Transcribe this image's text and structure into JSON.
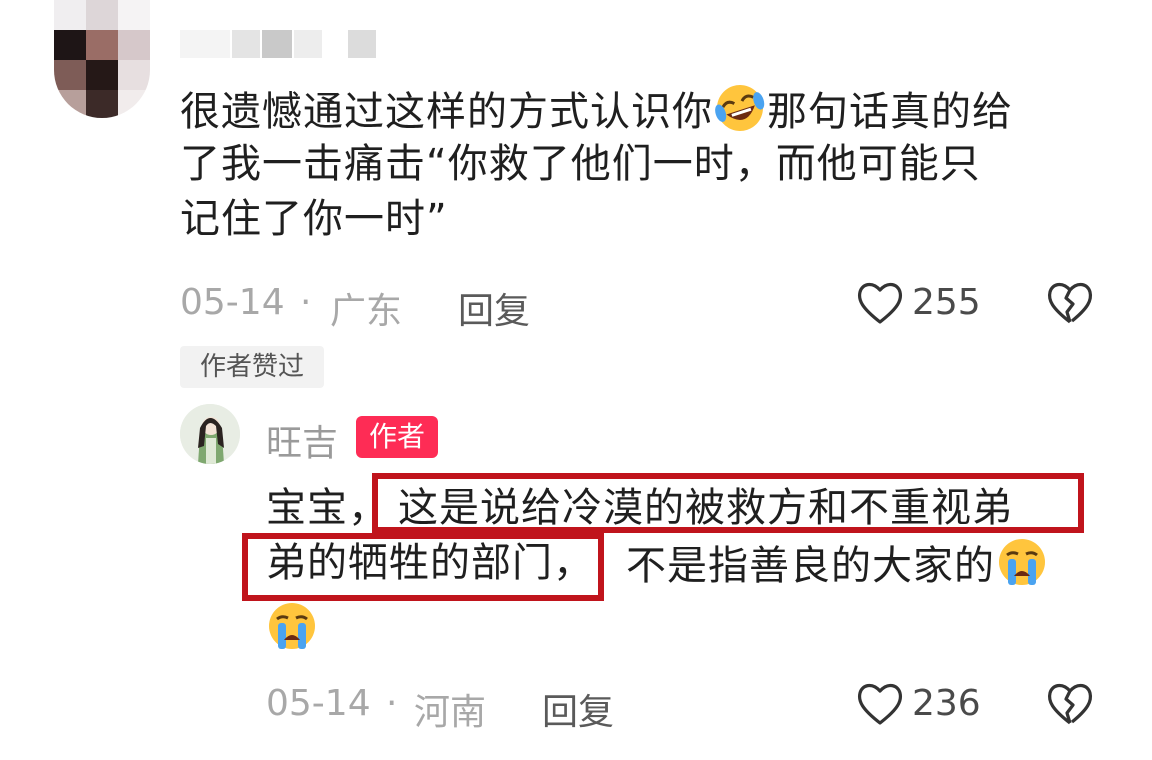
{
  "comment": {
    "text_line1_a": "很遗憾通过这样的方式认识你",
    "text_line1_emoji": "laughing-tears-emoji",
    "text_line1_b": "那句话真的给",
    "text_line2": "了我一击痛击“你救了他们一时，而他可能只",
    "text_line3": "记住了你一时”",
    "date": "05-14",
    "separator": "·",
    "location": "广东",
    "reply_label": "回复",
    "like_count": "255",
    "liked_by_author": "作者赞过"
  },
  "reply": {
    "author": "旺吉",
    "author_badge": "作者",
    "text_line1_a": "宝宝，",
    "text_line1_b": "这是说给冷漠的被救方和不重视弟",
    "text_line2_a": "弟的牺牲的部门，",
    "text_line2_b": "不是指善良的大家的",
    "emoji": "crying-emoji",
    "date": "05-14",
    "separator": "·",
    "location": "河南",
    "reply_label": "回复",
    "like_count": "236"
  },
  "icons": {
    "like": "heart-outline-icon",
    "dislike": "broken-heart-icon"
  },
  "colors": {
    "badge": "#fe2c55",
    "highlight_box": "#c0141c",
    "meta_text": "#a8a8a8"
  }
}
